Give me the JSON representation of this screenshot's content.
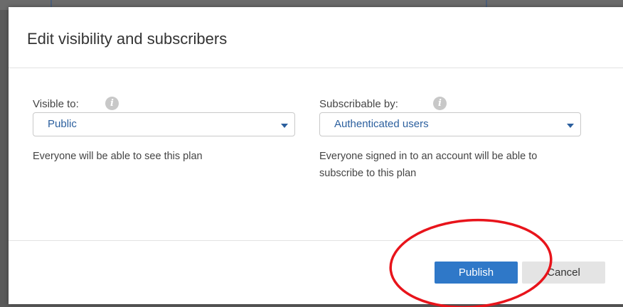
{
  "dialog": {
    "title": "Edit visibility and subscribers"
  },
  "visibility": {
    "label": "Visible to:",
    "info_glyph": "i",
    "selected": "Public",
    "help": "Everyone will be able to see this plan"
  },
  "subscribers": {
    "label": "Subscribable by:",
    "info_glyph": "i",
    "selected": "Authenticated users",
    "help_line1": "Everyone signed in to an account will be able to",
    "help_line2": "subscribe to this plan"
  },
  "footer": {
    "publish_label": "Publish",
    "cancel_label": "Cancel"
  },
  "colors": {
    "primary": "#2f78c8",
    "link_text": "#2b5f9e",
    "annotation": "#e8141b"
  },
  "icons": {
    "info": "info-icon",
    "dropdown": "chevron-down-icon"
  }
}
